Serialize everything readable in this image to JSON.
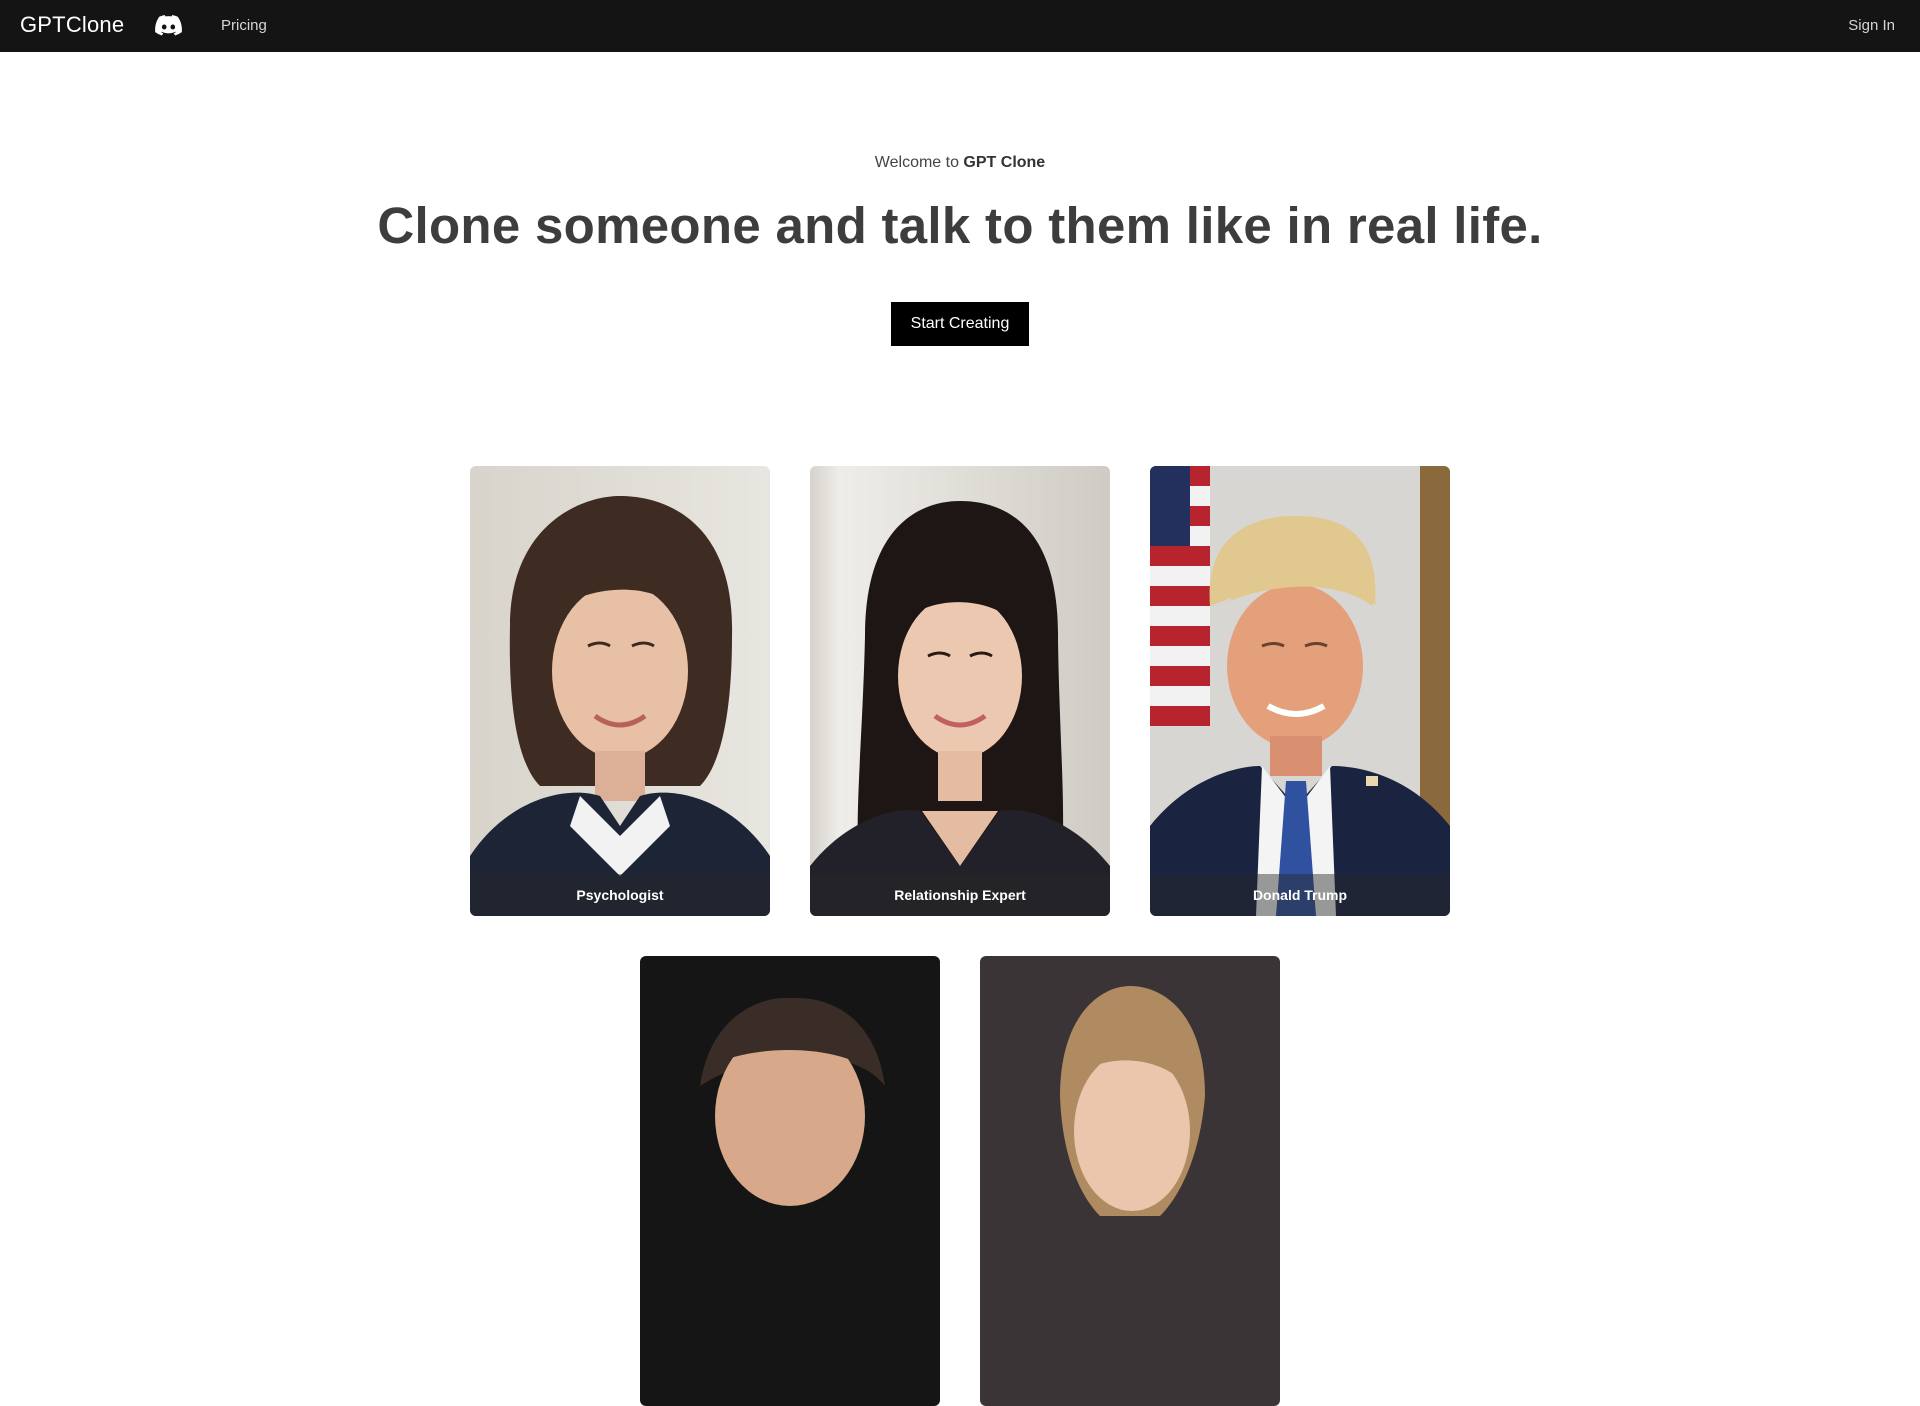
{
  "nav": {
    "brand": "GPTClone",
    "discord_icon": "discord-icon",
    "pricing": "Pricing",
    "sign_in": "Sign In"
  },
  "hero": {
    "welcome_prefix": "Welcome to ",
    "welcome_brand": "GPT Clone",
    "headline": "Clone someone and talk to them like in real life.",
    "cta": "Start Creating"
  },
  "cards": [
    {
      "label": "Psychologist"
    },
    {
      "label": "Relationship Expert"
    },
    {
      "label": "Donald Trump"
    },
    {
      "label": ""
    },
    {
      "label": ""
    }
  ],
  "colors": {
    "navbar_bg": "#141414",
    "cta_bg": "#000000",
    "headline": "#3d3d3d"
  }
}
